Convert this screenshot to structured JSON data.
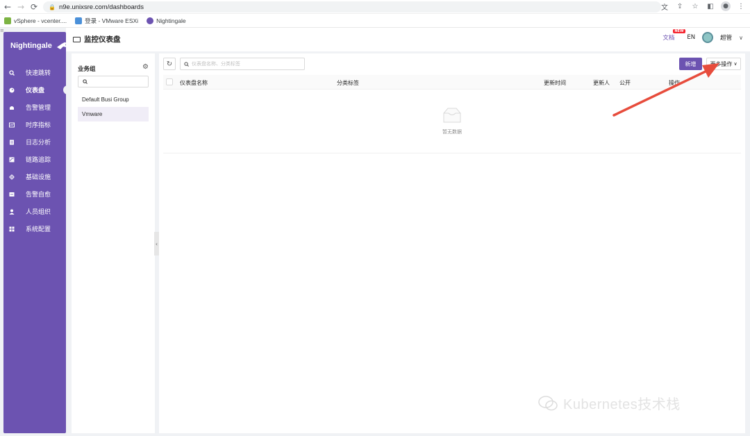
{
  "browser": {
    "url": "n9e.unixsre.com/dashboards",
    "bookmarks": [
      {
        "label": "vSphere - vcenter...."
      },
      {
        "label": "登录 - VMware ESXi"
      },
      {
        "label": "Nightingale"
      }
    ]
  },
  "sidebar": {
    "brand": "Nightingale",
    "items": [
      {
        "label": "快速跳转",
        "icon": "search-icon"
      },
      {
        "label": "仪表盘",
        "icon": "dashboard-icon",
        "active": true
      },
      {
        "label": "告警管理",
        "icon": "alarm-icon"
      },
      {
        "label": "时序指标",
        "icon": "metrics-icon"
      },
      {
        "label": "日志分析",
        "icon": "log-icon"
      },
      {
        "label": "链路追踪",
        "icon": "trace-icon"
      },
      {
        "label": "基础设施",
        "icon": "infra-icon"
      },
      {
        "label": "告警自愈",
        "icon": "self-heal-icon"
      },
      {
        "label": "人员组织",
        "icon": "user-icon"
      },
      {
        "label": "系统配置",
        "icon": "settings-grid-icon"
      }
    ]
  },
  "header": {
    "title": "监控仪表盘",
    "docs": "文档",
    "new_badge": "NEW",
    "lang": "EN",
    "user": "超管"
  },
  "group_panel": {
    "title": "业务组",
    "search_value": "",
    "groups": [
      "Default Busi Group",
      "Vmware"
    ],
    "selected": "Vmware"
  },
  "main": {
    "search_placeholder": "仪表盘名称、分类标签",
    "new_button": "新增",
    "more_button": "更多操作",
    "columns": [
      "仪表盘名称",
      "分类标签",
      "更新时间",
      "更新人",
      "公开",
      "操作"
    ],
    "empty_text": "暂无数据"
  },
  "watermark": "Kubernetes技术栈",
  "colors": {
    "accent": "#6c53b1",
    "arrow": "#e74c3c"
  }
}
